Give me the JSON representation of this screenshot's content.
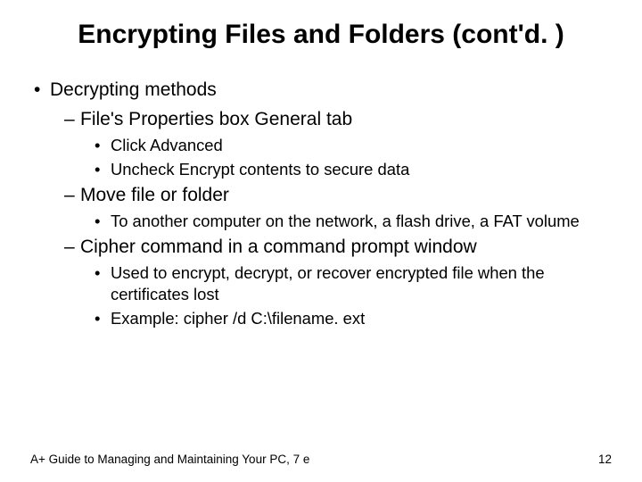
{
  "title": "Encrypting Files and Folders (cont'd. )",
  "b1": "Decrypting methods",
  "b1_1": "File's Properties box General tab",
  "b1_1_1": "Click Advanced",
  "b1_1_2": "Uncheck Encrypt contents to secure data",
  "b1_2": "Move file or folder",
  "b1_2_1": "To another computer on the network, a flash drive, a FAT volume",
  "b1_3": "Cipher command in a command prompt window",
  "b1_3_1": "Used to encrypt, decrypt, or recover encrypted file when the certificates lost",
  "b1_3_2": "Example: cipher /d C:\\filename. ext",
  "footer_left": "A+ Guide to Managing and Maintaining Your PC, 7 e",
  "footer_right": "12"
}
